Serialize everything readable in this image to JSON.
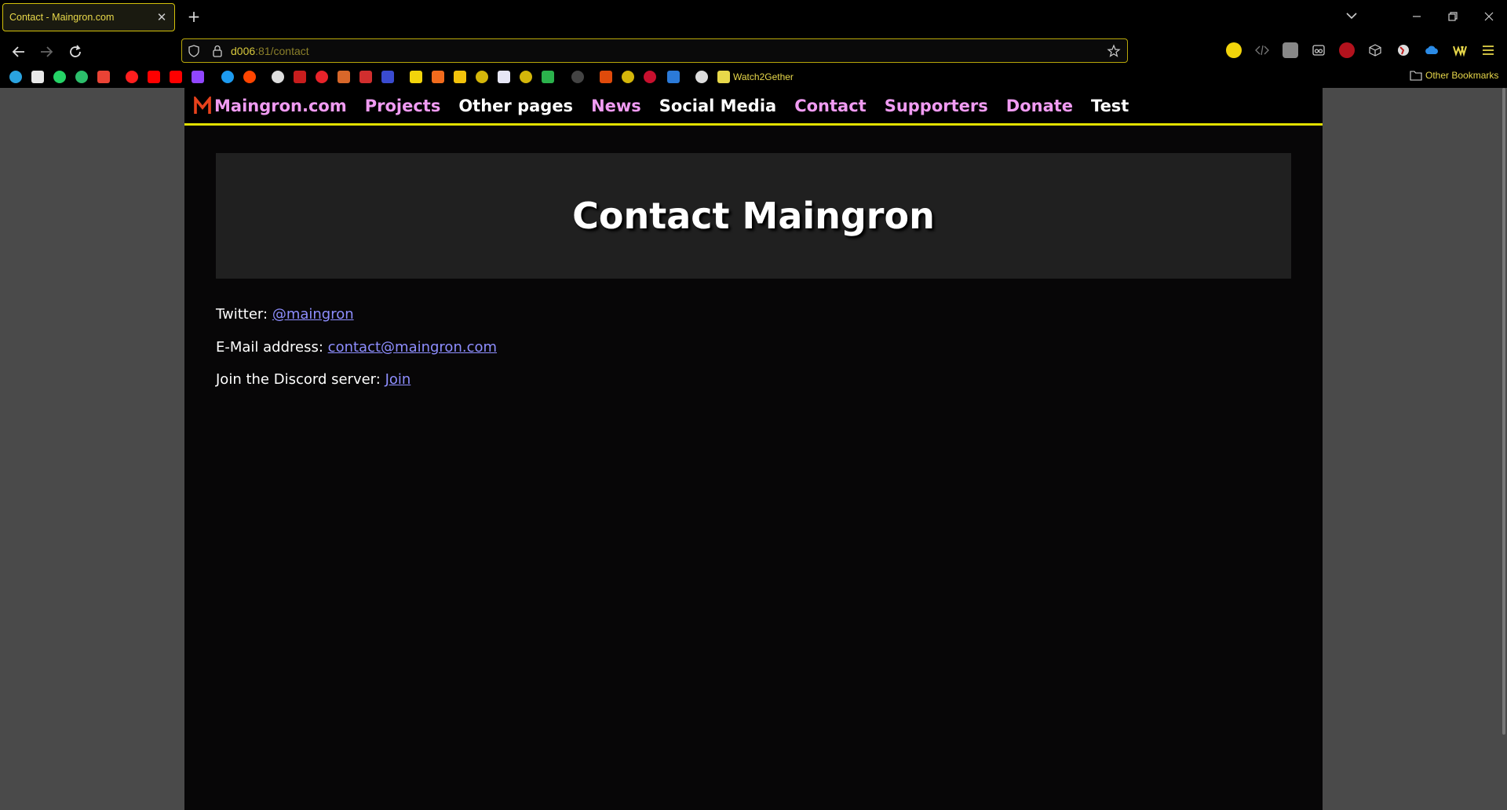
{
  "browser": {
    "tab": {
      "title": "Contact - Maingron.com",
      "close": "✕"
    },
    "new_tab": "+",
    "url": {
      "host": "d006",
      "path": ":81/contact"
    },
    "bookmarks": {
      "watch2gether": "Watch2Gether",
      "other": "Other Bookmarks"
    }
  },
  "site": {
    "nav": {
      "brand": "Maingron.com",
      "items": [
        "Projects",
        "Other pages",
        "News",
        "Social Media",
        "Contact",
        "Supporters",
        "Donate",
        "Test"
      ]
    },
    "hero_title": "Contact Maingron",
    "contacts": {
      "twitter_label": "Twitter:",
      "twitter_link": "@maingron",
      "email_label": "E-Mail address:",
      "email_link": "contact@maingron.com",
      "discord_label": "Join the Discord server:",
      "discord_link": "Join"
    }
  },
  "colors": {
    "accent": "#e2e000",
    "nav_pink": "#f09bf2",
    "link": "#8e8eff"
  }
}
